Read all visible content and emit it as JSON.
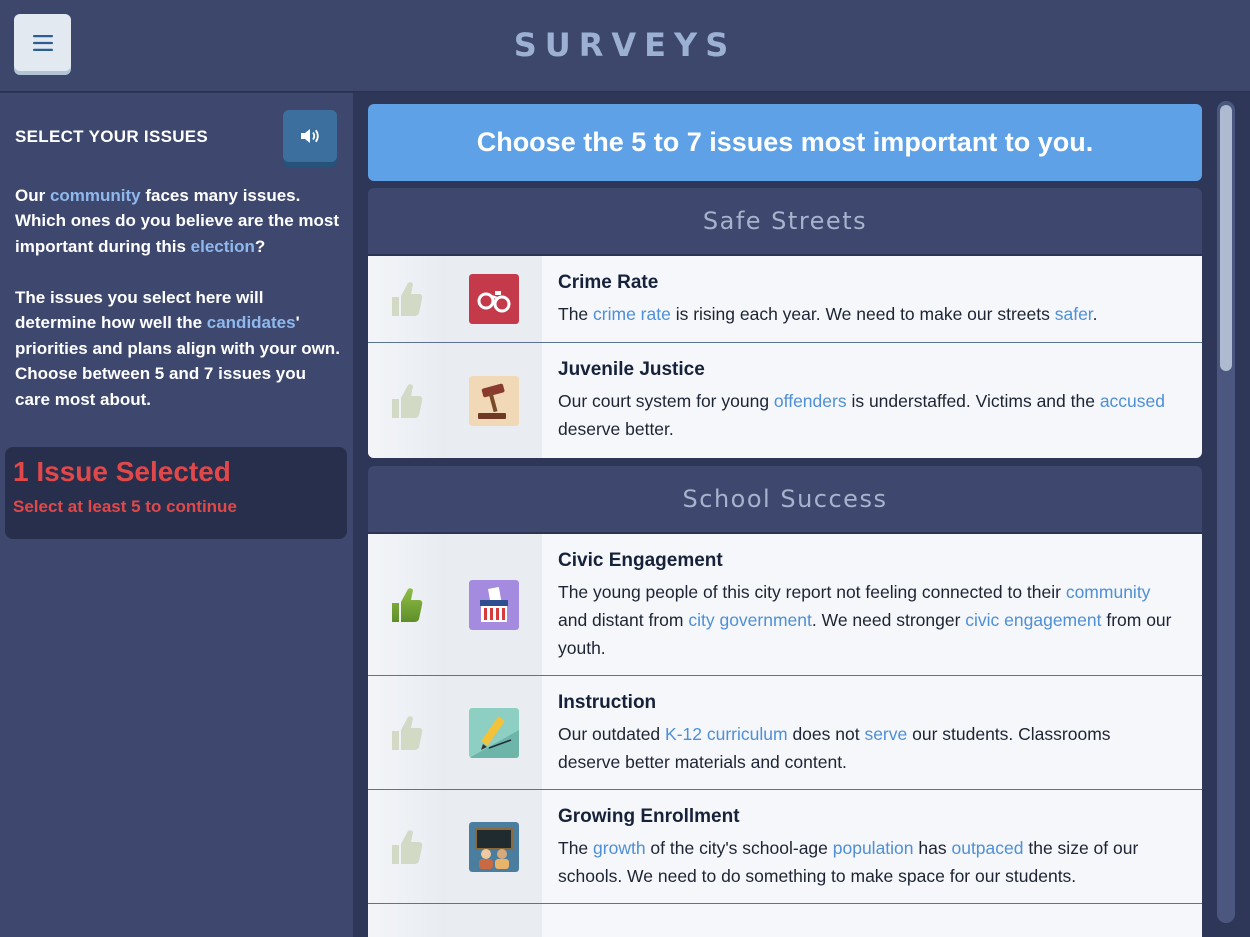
{
  "header": {
    "title": "SURVEYS",
    "menu_icon": "hamburger-icon"
  },
  "sidebar": {
    "heading": "SELECT YOUR ISSUES",
    "audio_icon": "speaker-icon",
    "para1": [
      "Our ",
      "community",
      " faces many issues. Which ones do you believe are the most important during this ",
      "election",
      "?"
    ],
    "para2": [
      "The issues you select here will determine how well the ",
      "candidates",
      "' priorities and plans align with your own. Choose between 5 and 7 issues you care most about."
    ],
    "status": {
      "count": "1 Issue Selected",
      "hint": "Select at least 5 to continue"
    }
  },
  "main": {
    "banner": "Choose the 5 to 7 issues most important to you.",
    "sections": [
      {
        "title": "Safe Streets",
        "issues": [
          {
            "title": "Crime Rate",
            "icon": "handcuffs-icon",
            "selected": false,
            "desc": [
              "The ",
              "crime rate",
              " is rising each year. We need to make our streets ",
              "safer",
              "."
            ]
          },
          {
            "title": "Juvenile Justice",
            "icon": "gavel-icon",
            "selected": false,
            "desc": [
              "Our court system for young ",
              "offenders",
              " is understaffed. Victims and the ",
              "accused",
              " deserve better."
            ]
          }
        ]
      },
      {
        "title": "School Success",
        "issues": [
          {
            "title": "Civic Engagement",
            "icon": "ballot-box-icon",
            "selected": true,
            "desc": [
              "The young people of this city report not feeling connected to their ",
              "community",
              " and distant from ",
              "city government",
              ". We need stronger ",
              "civic engagement",
              " from our youth."
            ]
          },
          {
            "title": "Instruction",
            "icon": "pencil-icon",
            "selected": false,
            "desc": [
              "Our outdated ",
              "K-12 curriculum",
              " does not ",
              "serve",
              " our students. Classrooms deserve better materials and content."
            ]
          },
          {
            "title": "Growing Enrollment",
            "icon": "classroom-icon",
            "selected": false,
            "desc": [
              "The ",
              "growth",
              " of the city's school-age ",
              "population",
              " has ",
              "outpaced",
              " the size of our schools. We need to do something to make space for our students."
            ]
          }
        ]
      }
    ]
  },
  "colors": {
    "accent": "#5ea1e6",
    "alert": "#e0484a",
    "link": "#4e8fd6",
    "selected_thumb": "#7fae3c",
    "unselected_thumb": "#d2d9c5"
  }
}
